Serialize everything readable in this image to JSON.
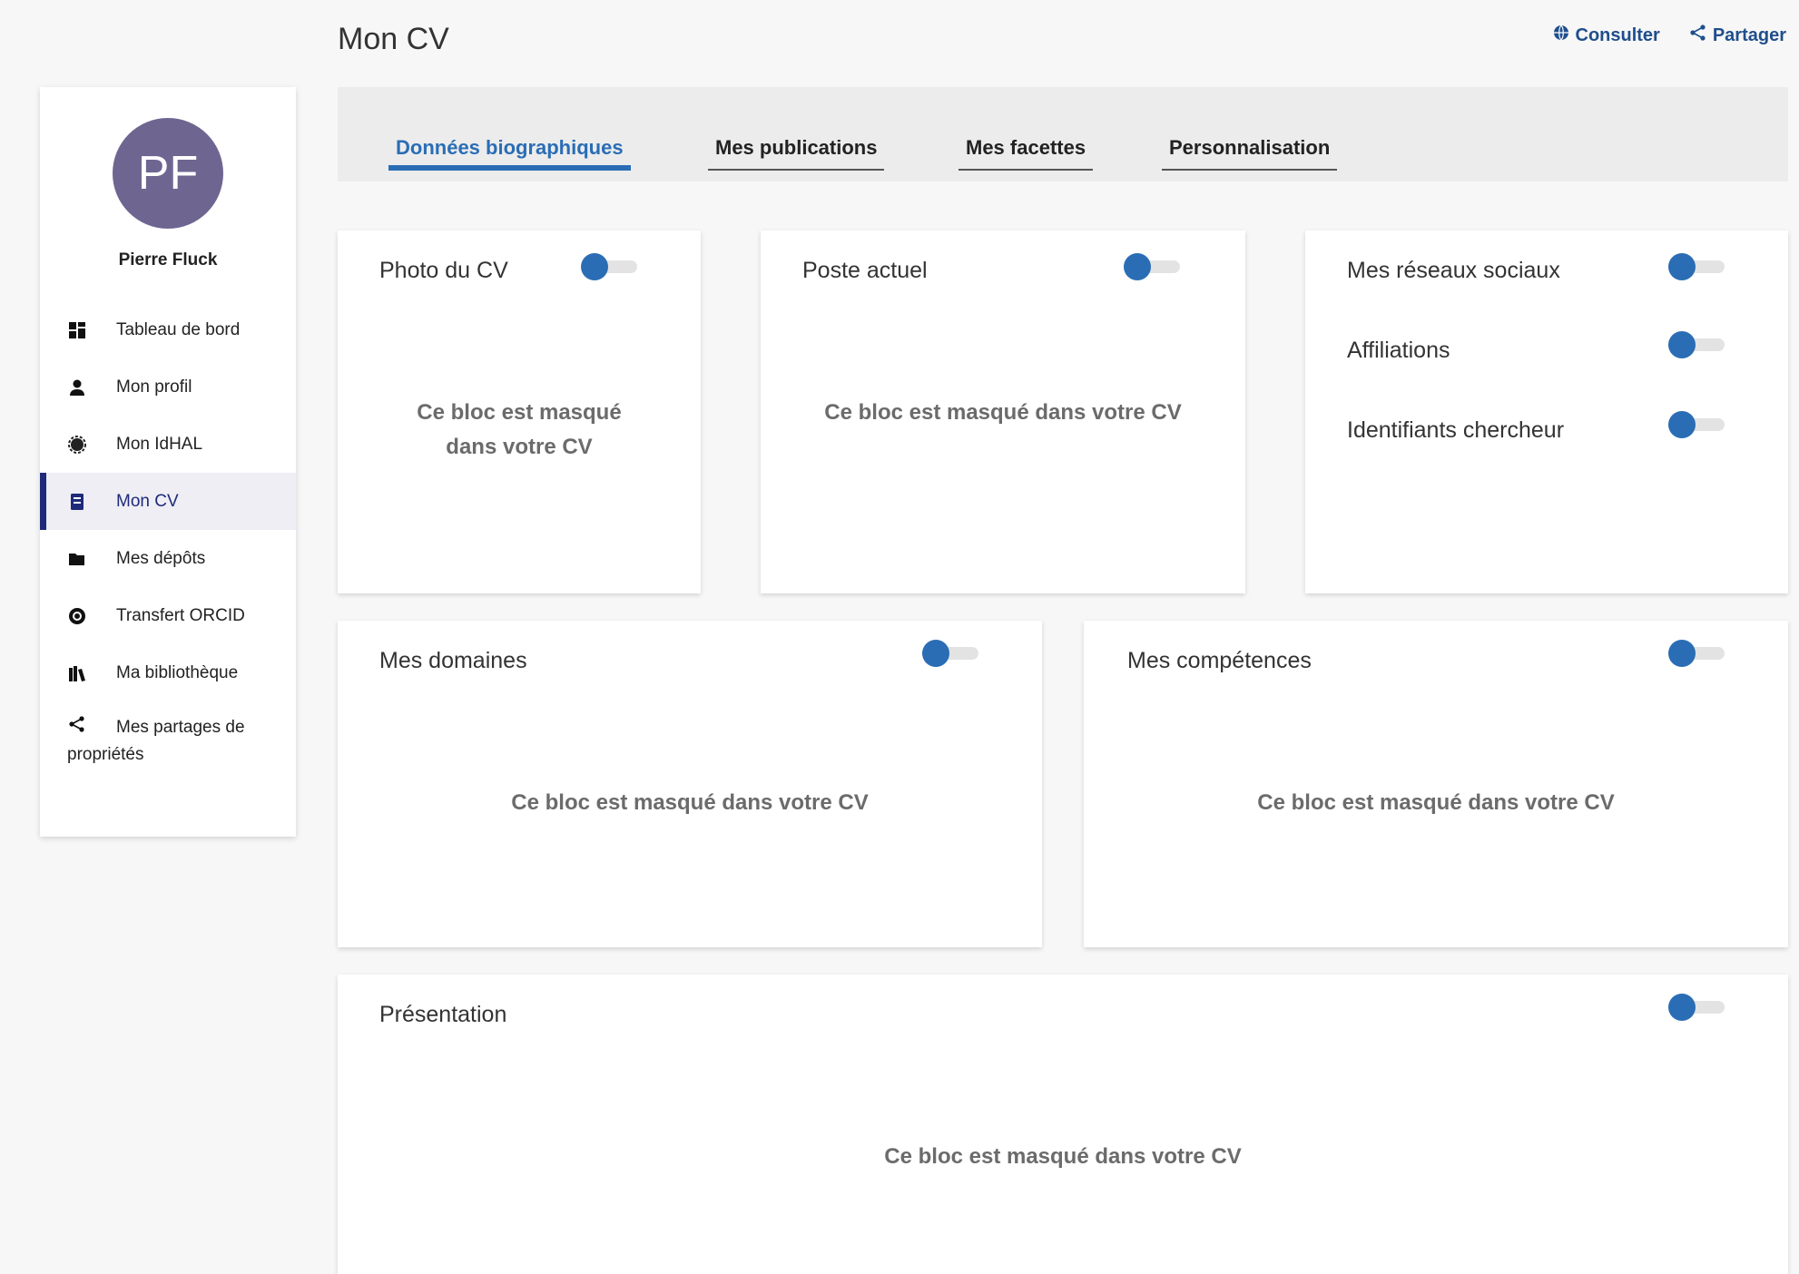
{
  "header": {
    "title": "Mon CV",
    "actions": [
      {
        "label": "Consulter",
        "icon": "globe-icon"
      },
      {
        "label": "Partager",
        "icon": "share-icon"
      }
    ]
  },
  "sidebar": {
    "avatar_initials": "PF",
    "avatar_color": "#6e6691",
    "user_name": "Pierre Fluck",
    "items": [
      {
        "label": "Tableau de bord",
        "icon": "dashboard-icon"
      },
      {
        "label": "Mon profil",
        "icon": "user-icon"
      },
      {
        "label": "Mon IdHAL",
        "icon": "gear-badge-icon"
      },
      {
        "label": "Mon CV",
        "icon": "cv-document-icon",
        "active": true
      },
      {
        "label": "Mes dépôts",
        "icon": "folder-open-icon"
      },
      {
        "label": "Transfert ORCID",
        "icon": "orcid-icon"
      },
      {
        "label": "Ma bibliothèque",
        "icon": "library-icon"
      },
      {
        "label": "Mes partages de propriétés",
        "icon": "share-icon"
      }
    ]
  },
  "tabs": [
    {
      "label": "Données biographiques",
      "active": true
    },
    {
      "label": "Mes publications"
    },
    {
      "label": "Mes facettes"
    },
    {
      "label": "Personnalisation"
    }
  ],
  "masked_text": "Ce bloc est masqué dans votre CV",
  "cards": {
    "photo": {
      "title": "Photo du CV",
      "masked_line1": "Ce bloc est masqué",
      "masked_line2": "dans votre CV"
    },
    "poste": {
      "title": "Poste actuel"
    },
    "social": {
      "rows": [
        "Mes réseaux sociaux",
        "Affiliations",
        "Identifiants chercheur"
      ]
    },
    "domaines": {
      "title": "Mes domaines"
    },
    "competences": {
      "title": "Mes compétences"
    },
    "presentation": {
      "title": "Présentation"
    }
  },
  "colors": {
    "accent": "#2a6db5",
    "nav_active": "#1f2a7a",
    "action_link": "#1f4e8c"
  }
}
